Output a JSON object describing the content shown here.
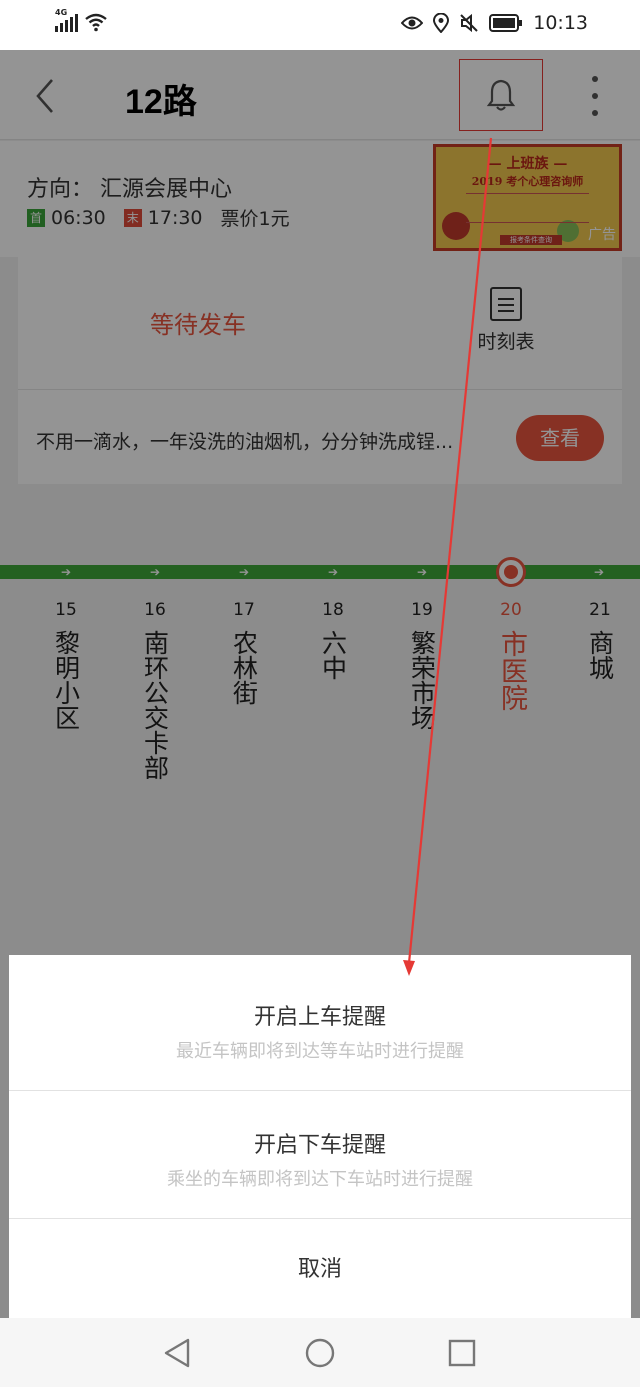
{
  "status_bar": {
    "network": "4G",
    "time": "10:13",
    "icons": [
      "signal-icon",
      "wifi-icon",
      "eye-icon",
      "location-icon",
      "mute-icon",
      "battery-icon"
    ]
  },
  "header": {
    "title": "12路",
    "icons": [
      "back-icon",
      "bell-icon",
      "more-icon"
    ]
  },
  "direction": {
    "label": "方向：",
    "destination": "汇源会展中心",
    "first_badge": "首",
    "first_time": "06:30",
    "last_badge": "末",
    "last_time": "17:30",
    "fare": "票价1元"
  },
  "ad": {
    "title": "— 上班族 —",
    "subtitle": "2019 考个心理咨询师",
    "button": "报考条件查询",
    "tag": "广告"
  },
  "card": {
    "status": "等待发车",
    "timetable_label": "时刻表",
    "promo_text": "不用一滴水，一年没洗的油烟机，分分钟洗成锃...",
    "view_button": "查看"
  },
  "stops": [
    {
      "num": "15",
      "name": "黎明小区"
    },
    {
      "num": "16",
      "name": "南环公交卡部"
    },
    {
      "num": "17",
      "name": "农林街"
    },
    {
      "num": "18",
      "name": "六中"
    },
    {
      "num": "19",
      "name": "繁荣市场"
    },
    {
      "num": "20",
      "name": "市医院",
      "current": true
    },
    {
      "num": "21",
      "name": "商城"
    }
  ],
  "sheet": {
    "board_title": "开启上车提醒",
    "board_desc": "最近车辆即将到达等车站时进行提醒",
    "alight_title": "开启下车提醒",
    "alight_desc": "乘坐的车辆即将到达下车站时进行提醒",
    "cancel": "取消"
  },
  "colors": {
    "accent": "#e8553e",
    "route_line": "#3ea83a",
    "annotation": "#e53935"
  }
}
